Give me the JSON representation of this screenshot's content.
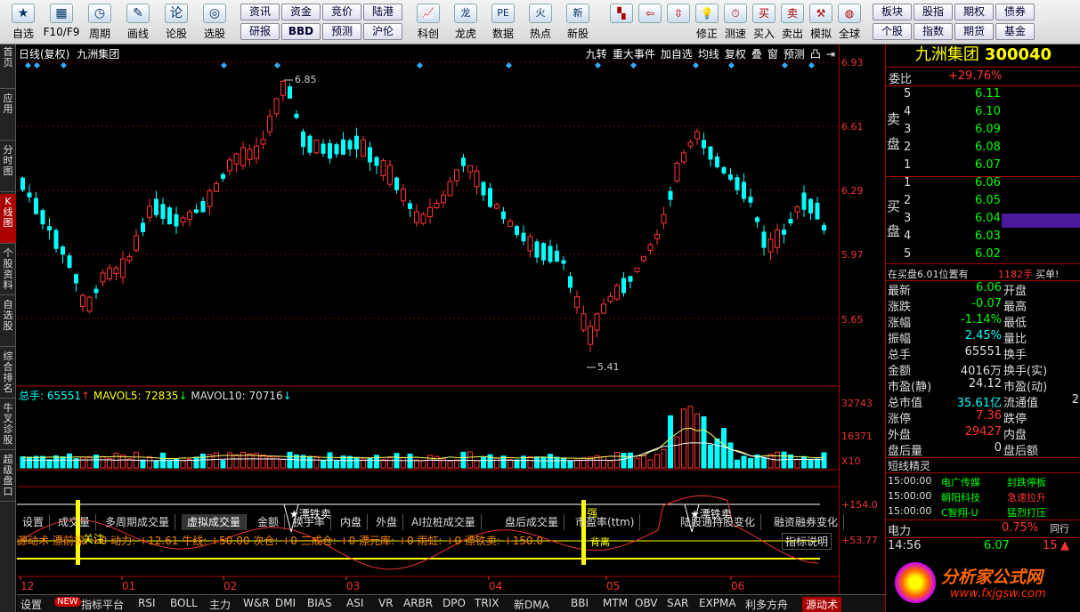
{
  "toolbar": {
    "buttons": [
      {
        "label": "自选",
        "icon": "star-icon",
        "glyph": "★"
      },
      {
        "label": "F10/F9",
        "icon": "grid-icon",
        "glyph": "▦"
      },
      {
        "label": "周期",
        "icon": "clock-icon",
        "glyph": "◷"
      },
      {
        "label": "画线",
        "icon": "pen-icon",
        "glyph": "✎"
      },
      {
        "label": "论股",
        "icon": "chat-icon",
        "glyph": "论"
      },
      {
        "label": "选股",
        "icon": "radar-icon",
        "glyph": "◎"
      }
    ],
    "grid_buttons": [
      [
        "资讯",
        "资金",
        "竞价",
        "陆港"
      ],
      [
        "研报",
        "BBD",
        "预测",
        "沪伦"
      ]
    ],
    "buttons2": [
      {
        "label": "科创",
        "icon": "chart-icon",
        "glyph": "📈"
      },
      {
        "label": "龙虎",
        "icon": "dragon-icon",
        "glyph": "龙"
      },
      {
        "label": "数据",
        "icon": "pe-icon",
        "glyph": "PE"
      },
      {
        "label": "热点",
        "icon": "fire-icon",
        "glyph": "火"
      },
      {
        "label": "新股",
        "icon": "new-icon",
        "glyph": "新"
      }
    ],
    "buttons3": [
      {
        "label": "",
        "icon": "color-blocks-icon",
        "glyph": "▚"
      },
      {
        "label": "",
        "icon": "arrow-left-icon",
        "glyph": "⇦"
      },
      {
        "label": "",
        "icon": "arrow-up-down-icon",
        "glyph": "⇳"
      },
      {
        "label": "修正",
        "icon": "lightbulb-icon",
        "glyph": "💡"
      },
      {
        "label": "测速",
        "icon": "stopwatch-icon",
        "glyph": "⏱"
      },
      {
        "label": "买入",
        "icon": "buy-icon",
        "glyph": "买"
      },
      {
        "label": "卖出",
        "icon": "sell-icon",
        "glyph": "卖"
      },
      {
        "label": "模拟",
        "icon": "hammer-icon",
        "glyph": "⚒"
      },
      {
        "label": "全球",
        "icon": "globe-icon",
        "glyph": "◍"
      }
    ],
    "grid_buttons2": [
      [
        "板块",
        "股指",
        "期权",
        "债券"
      ],
      [
        "个股",
        "指数",
        "期货",
        "基金"
      ]
    ]
  },
  "left_tabs": [
    "首页",
    "应用",
    "分时图",
    "K线图",
    "个股资料",
    "自选股",
    "综合排名",
    "牛叉诊股",
    "超级盘口"
  ],
  "chart": {
    "title": "日线(复权)",
    "stock_name": "九洲集团",
    "top_buttons": [
      "九转",
      "重大事件",
      "加自选",
      "均线",
      "复权",
      "叠",
      "窗",
      "预测",
      "凸",
      "⇥"
    ],
    "high_label": "6.85",
    "low_label": "5.41",
    "price_ticks": [
      "6.93",
      "6.61",
      "6.29",
      "5.97",
      "5.65"
    ],
    "vol_legend": {
      "total": "总手: 65551",
      "ma5": "MAVOL5: 72835",
      "ma10": "MAVOL10: 70716"
    },
    "vol_ticks": [
      "32743",
      "16371",
      "X10"
    ],
    "indicator_tabs": [
      "设置",
      "成交量",
      "多周期成交量",
      "虚拟成交量",
      "金额",
      "换手率",
      "内盘",
      "外盘",
      "AI拉桩成交量",
      "盘后成交量",
      "市盈率(ttm)",
      "陆股通持股变化",
      "融资融券变化"
    ],
    "ind_legend": "源动术  漂前探: +0  动力: +12.61  牛线: +50.00  次仓: +0  三成仓: +0  漂元库: +0  雨虹: +0  漂铁卖: +150.0",
    "ind_help": "指标说明",
    "ind_ticks": [
      "+154.0",
      "+53.77"
    ],
    "ind_marks": [
      "漂铁卖",
      "漂铁卖",
      "关注",
      "强",
      "背离"
    ],
    "months": [
      "12",
      "01",
      "02",
      "03",
      "04",
      "05",
      "06"
    ]
  },
  "chart_data": {
    "type": "candlestick",
    "x": [
      "12",
      "01",
      "02",
      "03",
      "04",
      "05",
      "06"
    ],
    "price_range": [
      5.41,
      6.93
    ],
    "high": 6.85,
    "low": 5.41
  },
  "panel": {
    "title": "九洲集团",
    "code": "300040",
    "weibi_label": "委比",
    "weibi": "+29.76%",
    "sell_label": [
      "卖",
      "盘"
    ],
    "buy_label": [
      "买",
      "盘"
    ],
    "asks": [
      [
        "5",
        "6.11"
      ],
      [
        "4",
        "6.10"
      ],
      [
        "3",
        "6.09"
      ],
      [
        "2",
        "6.08"
      ],
      [
        "1",
        "6.07"
      ]
    ],
    "bids": [
      [
        "1",
        "6.06"
      ],
      [
        "2",
        "6.05"
      ],
      [
        "3",
        "6.04"
      ],
      [
        "4",
        "6.03"
      ],
      [
        "5",
        "6.02"
      ]
    ],
    "notice": "在买盘6.01位置有",
    "notice_qty": "1182手",
    "notice_tail": "买单!",
    "stats": [
      [
        "最新",
        "6.06",
        "开盘",
        ""
      ],
      [
        "涨跌",
        "-0.07",
        "最高",
        ""
      ],
      [
        "涨幅",
        "-1.14%",
        "最低",
        ""
      ],
      [
        "振幅",
        "2.45%",
        "量比",
        ""
      ],
      [
        "总手",
        "65551",
        "换手",
        ""
      ],
      [
        "金额",
        "4016万",
        "换手(实)",
        ""
      ],
      [
        "市盈(静)",
        "24.12",
        "市盈(动)",
        ""
      ],
      [
        "总市值",
        "35.61亿",
        "流通值",
        "2"
      ],
      [
        "涨停",
        "7.36",
        "跌停",
        ""
      ],
      [
        "外盘",
        "29427",
        "内盘",
        ""
      ],
      [
        "盘后量",
        "0",
        "盘后额",
        ""
      ]
    ],
    "jingling_title": "短线精灵",
    "jingling": [
      [
        "15:00:00",
        "电广传媒",
        "封跌停板"
      ],
      [
        "15:00:00",
        "朝阳科技",
        "急速拉升"
      ],
      [
        "15:00:00",
        "C智翔-U",
        "猛烈打压"
      ]
    ],
    "power_label": "电力",
    "power_val": "0.75%",
    "power_tail": "同行",
    "tick_time": "14:56",
    "tick_price": "6.07",
    "tick_qty": "15",
    "watermark": "分析家公式网",
    "watermark_url": "www.fxjgsw.com"
  },
  "bottom_tabs": [
    "设置",
    "NEW",
    "指标平台",
    "RSI",
    "BOLL",
    "主力",
    "W&R",
    "DMI",
    "BIAS",
    "ASI",
    "VR",
    "ARBR",
    "DPO",
    "TRIX",
    "新DMA",
    "BBI",
    "MTM",
    "OBV",
    "SAR",
    "EXPMA",
    "利多方舟",
    "源动术"
  ],
  "colors": {
    "up": "#ff3333",
    "down": "#00ffff",
    "bg": "#000000",
    "grid": "#800000"
  }
}
